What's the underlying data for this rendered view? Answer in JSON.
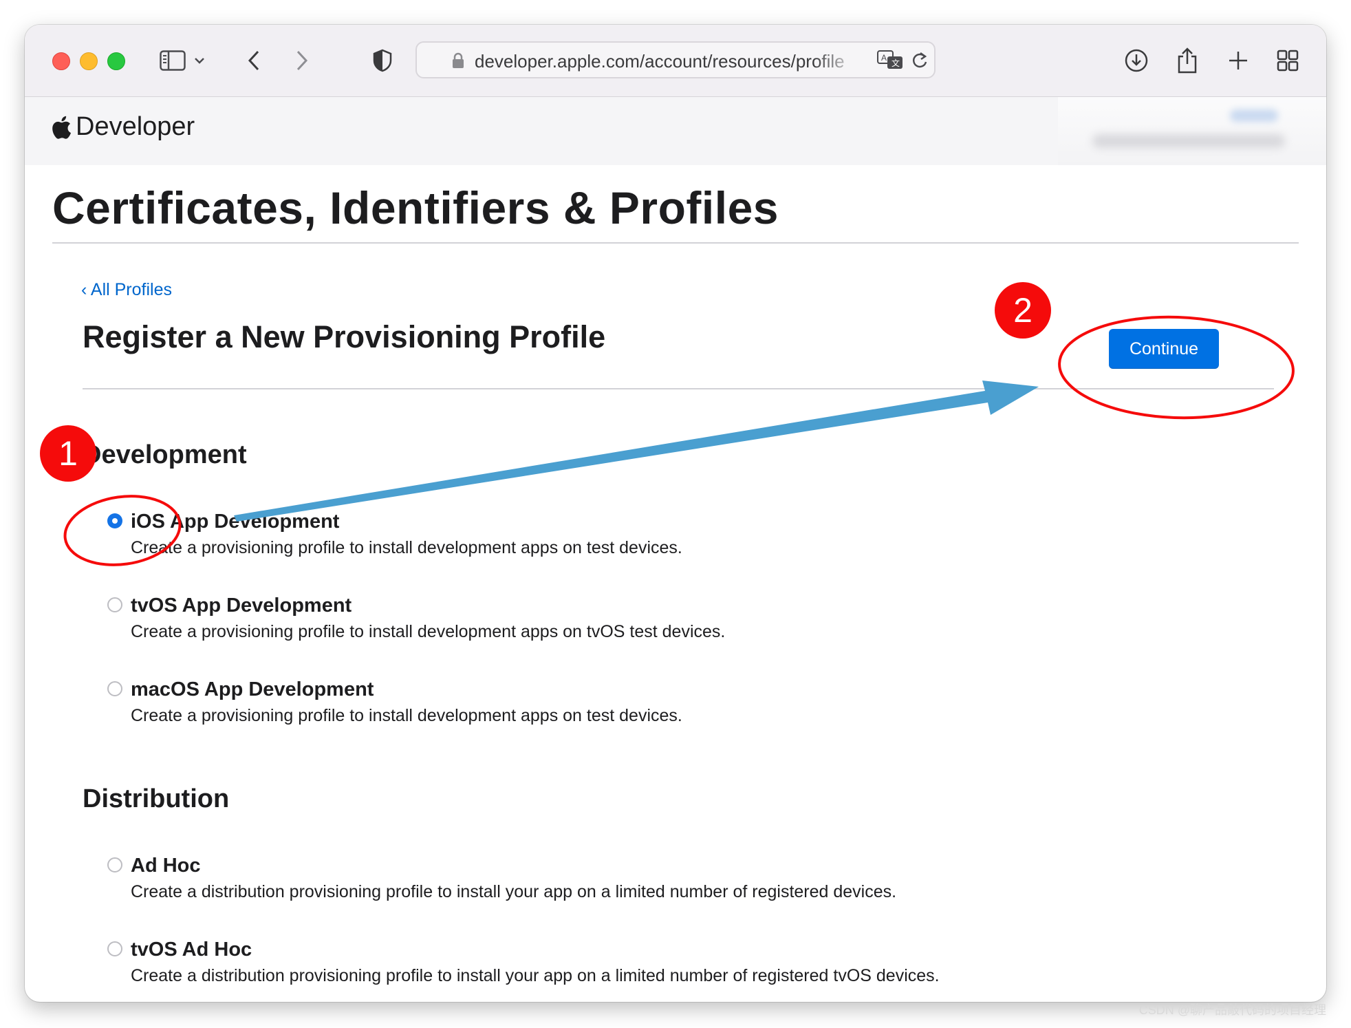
{
  "browser": {
    "url": "developer.apple.com/account/resources/profile",
    "toolbar_icons": [
      "sidebar-icon",
      "chevron-down-icon",
      "back-icon",
      "forward-icon",
      "privacy-shield-icon",
      "lock-icon",
      "translate-icon",
      "reload-icon",
      "download-icon",
      "share-icon",
      "new-tab-icon",
      "tab-overview-icon"
    ]
  },
  "site": {
    "brand": "Developer",
    "logo": "apple-logo-icon"
  },
  "page": {
    "title": "Certificates, Identifiers & Profiles",
    "back_link": "‹ All Profiles",
    "section_title": "Register a New Provisioning Profile",
    "continue_label": "Continue"
  },
  "groups": [
    {
      "title": "Development",
      "options": [
        {
          "title": "iOS App Development",
          "description": "Create a provisioning profile to install development apps on test devices.",
          "selected": true
        },
        {
          "title": "tvOS App Development",
          "description": "Create a provisioning profile to install development apps on tvOS test devices.",
          "selected": false
        },
        {
          "title": "macOS App Development",
          "description": "Create a provisioning profile to install development apps on test devices.",
          "selected": false
        }
      ]
    },
    {
      "title": "Distribution",
      "options": [
        {
          "title": "Ad Hoc",
          "description": "Create a distribution provisioning profile to install your app on a limited number of registered devices.",
          "selected": false
        },
        {
          "title": "tvOS Ad Hoc",
          "description": "Create a distribution provisioning profile to install your app on a limited number of registered tvOS devices.",
          "selected": false
        }
      ]
    }
  ],
  "annotations": {
    "marker_1": "1",
    "marker_2": "2",
    "color": "#f50b0b",
    "arrow_color": "#4a9fd0"
  },
  "watermark": "CSDN @聊产品敲代码的项目经理",
  "colors": {
    "link": "#0066cc",
    "button": "#0071e3",
    "radio_selected": "#1473e6"
  }
}
